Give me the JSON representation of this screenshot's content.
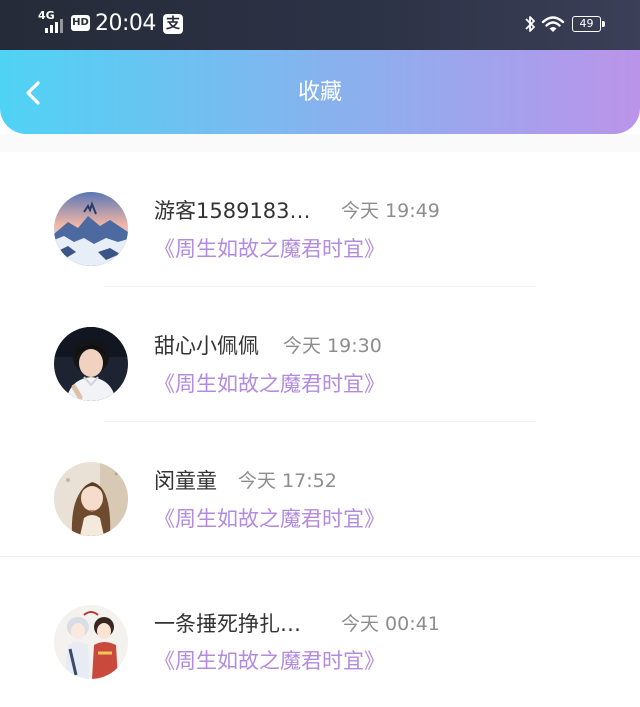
{
  "status_bar": {
    "network": "4G",
    "hd": "HD",
    "time": "20:04",
    "pay_icon": "支",
    "battery": "49"
  },
  "header": {
    "title": "收藏",
    "back_icon": "chevron-left-icon"
  },
  "favorites": [
    {
      "username": "游客1589183…",
      "time": "今天 19:49",
      "book": "《周生如故之魔君时宜》",
      "avatar": "snowy-landscape"
    },
    {
      "username": "甜心小佩佩",
      "time": "今天 19:30",
      "book": "《周生如故之魔君时宜》",
      "avatar": "young-man-portrait"
    },
    {
      "username": "闵童童",
      "time": "今天 17:52",
      "book": "《周生如故之魔君时宜》",
      "avatar": "woman-portrait"
    },
    {
      "username": "一条捶死挣扎…",
      "time": "今天 00:41",
      "book": "《周生如故之魔君时宜》",
      "avatar": "anime-characters"
    }
  ],
  "colors": {
    "header_start": "#4fd3f5",
    "header_end": "#bb94ea",
    "book_title": "#b28be0",
    "time_text": "#8d8d8d"
  }
}
